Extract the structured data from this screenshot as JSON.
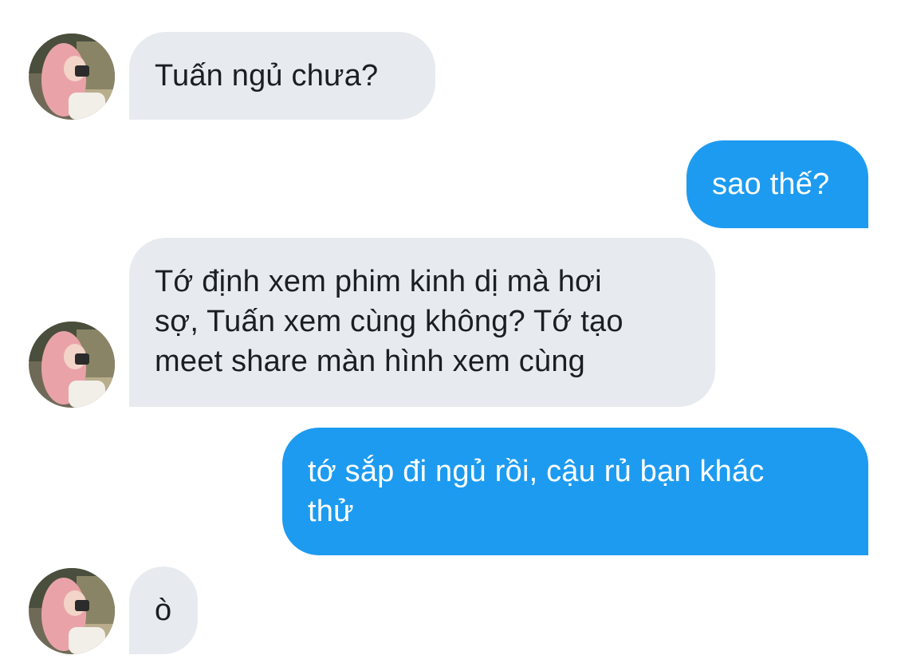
{
  "colors": {
    "incoming_bubble": "#e7ebf0",
    "outgoing_bubble": "#1d9bf0",
    "incoming_text": "#1b1f23",
    "outgoing_text": "#ffffff"
  },
  "messages": [
    {
      "direction": "incoming",
      "lines": [
        "Tuấn ngủ chưa?"
      ]
    },
    {
      "direction": "outgoing",
      "lines": [
        "sao thế?"
      ]
    },
    {
      "direction": "incoming",
      "lines": [
        "Tớ định xem phim kinh dị mà hơi",
        "sợ, Tuấn xem cùng không? Tớ tạo",
        "meet share màn hình xem cùng"
      ]
    },
    {
      "direction": "outgoing",
      "lines": [
        "tớ sắp đi ngủ rồi, cậu rủ bạn khác",
        "thử"
      ]
    },
    {
      "direction": "incoming",
      "lines": [
        "ò"
      ]
    }
  ]
}
